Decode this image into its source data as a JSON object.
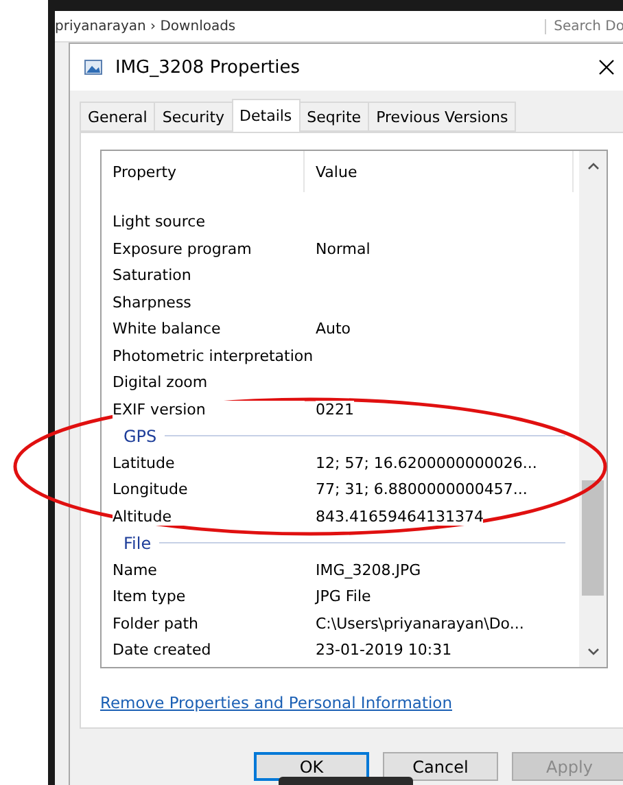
{
  "explorer": {
    "breadcrumb": "priyanarayan  ›  Downloads",
    "search": "Search Do"
  },
  "window": {
    "title": "IMG_3208 Properties"
  },
  "tabs": [
    {
      "label": "General",
      "selected": false
    },
    {
      "label": "Security",
      "selected": false
    },
    {
      "label": "Details",
      "selected": true
    },
    {
      "label": "Seqrite",
      "selected": false
    },
    {
      "label": "Previous Versions",
      "selected": false
    }
  ],
  "table": {
    "columns": [
      "Property",
      "Value"
    ],
    "rows": [
      {
        "kind": "item",
        "property": "Light source",
        "value": ""
      },
      {
        "kind": "item",
        "property": "Exposure program",
        "value": "Normal"
      },
      {
        "kind": "item",
        "property": "Saturation",
        "value": ""
      },
      {
        "kind": "item",
        "property": "Sharpness",
        "value": ""
      },
      {
        "kind": "item",
        "property": "White balance",
        "value": "Auto"
      },
      {
        "kind": "item",
        "property": "Photometric interpretation",
        "value": ""
      },
      {
        "kind": "item",
        "property": "Digital zoom",
        "value": ""
      },
      {
        "kind": "item",
        "property": "EXIF version",
        "value": "0221"
      },
      {
        "kind": "group",
        "label": "GPS"
      },
      {
        "kind": "item",
        "property": "Latitude",
        "value": "12; 57; 16.6200000000026..."
      },
      {
        "kind": "item",
        "property": "Longitude",
        "value": "77; 31; 6.8800000000457..."
      },
      {
        "kind": "item",
        "property": "Altitude",
        "value": "843.41659464131374"
      },
      {
        "kind": "group",
        "label": "File"
      },
      {
        "kind": "item",
        "property": "Name",
        "value": "IMG_3208.JPG"
      },
      {
        "kind": "item",
        "property": "Item type",
        "value": "JPG File"
      },
      {
        "kind": "item",
        "property": "Folder path",
        "value": "C:\\Users\\priyanarayan\\Do..."
      },
      {
        "kind": "item",
        "property": "Date created",
        "value": "23-01-2019 10:31"
      }
    ]
  },
  "link": "Remove Properties and Personal Information",
  "buttons": [
    {
      "label": "OK",
      "disabled": false,
      "default": true
    },
    {
      "label": "Cancel",
      "disabled": false,
      "default": false
    },
    {
      "label": "Apply",
      "disabled": true,
      "default": false
    }
  ]
}
